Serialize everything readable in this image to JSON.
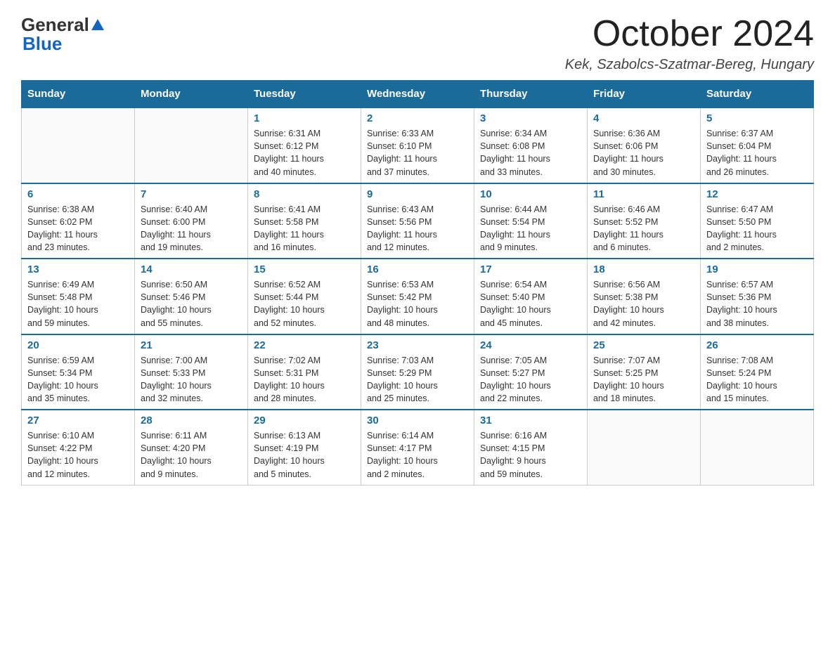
{
  "header": {
    "logo_general": "General",
    "logo_blue": "Blue",
    "month_title": "October 2024",
    "location": "Kek, Szabolcs-Szatmar-Bereg, Hungary"
  },
  "days_of_week": [
    "Sunday",
    "Monday",
    "Tuesday",
    "Wednesday",
    "Thursday",
    "Friday",
    "Saturday"
  ],
  "weeks": [
    [
      {
        "day": "",
        "info": ""
      },
      {
        "day": "",
        "info": ""
      },
      {
        "day": "1",
        "info": "Sunrise: 6:31 AM\nSunset: 6:12 PM\nDaylight: 11 hours\nand 40 minutes."
      },
      {
        "day": "2",
        "info": "Sunrise: 6:33 AM\nSunset: 6:10 PM\nDaylight: 11 hours\nand 37 minutes."
      },
      {
        "day": "3",
        "info": "Sunrise: 6:34 AM\nSunset: 6:08 PM\nDaylight: 11 hours\nand 33 minutes."
      },
      {
        "day": "4",
        "info": "Sunrise: 6:36 AM\nSunset: 6:06 PM\nDaylight: 11 hours\nand 30 minutes."
      },
      {
        "day": "5",
        "info": "Sunrise: 6:37 AM\nSunset: 6:04 PM\nDaylight: 11 hours\nand 26 minutes."
      }
    ],
    [
      {
        "day": "6",
        "info": "Sunrise: 6:38 AM\nSunset: 6:02 PM\nDaylight: 11 hours\nand 23 minutes."
      },
      {
        "day": "7",
        "info": "Sunrise: 6:40 AM\nSunset: 6:00 PM\nDaylight: 11 hours\nand 19 minutes."
      },
      {
        "day": "8",
        "info": "Sunrise: 6:41 AM\nSunset: 5:58 PM\nDaylight: 11 hours\nand 16 minutes."
      },
      {
        "day": "9",
        "info": "Sunrise: 6:43 AM\nSunset: 5:56 PM\nDaylight: 11 hours\nand 12 minutes."
      },
      {
        "day": "10",
        "info": "Sunrise: 6:44 AM\nSunset: 5:54 PM\nDaylight: 11 hours\nand 9 minutes."
      },
      {
        "day": "11",
        "info": "Sunrise: 6:46 AM\nSunset: 5:52 PM\nDaylight: 11 hours\nand 6 minutes."
      },
      {
        "day": "12",
        "info": "Sunrise: 6:47 AM\nSunset: 5:50 PM\nDaylight: 11 hours\nand 2 minutes."
      }
    ],
    [
      {
        "day": "13",
        "info": "Sunrise: 6:49 AM\nSunset: 5:48 PM\nDaylight: 10 hours\nand 59 minutes."
      },
      {
        "day": "14",
        "info": "Sunrise: 6:50 AM\nSunset: 5:46 PM\nDaylight: 10 hours\nand 55 minutes."
      },
      {
        "day": "15",
        "info": "Sunrise: 6:52 AM\nSunset: 5:44 PM\nDaylight: 10 hours\nand 52 minutes."
      },
      {
        "day": "16",
        "info": "Sunrise: 6:53 AM\nSunset: 5:42 PM\nDaylight: 10 hours\nand 48 minutes."
      },
      {
        "day": "17",
        "info": "Sunrise: 6:54 AM\nSunset: 5:40 PM\nDaylight: 10 hours\nand 45 minutes."
      },
      {
        "day": "18",
        "info": "Sunrise: 6:56 AM\nSunset: 5:38 PM\nDaylight: 10 hours\nand 42 minutes."
      },
      {
        "day": "19",
        "info": "Sunrise: 6:57 AM\nSunset: 5:36 PM\nDaylight: 10 hours\nand 38 minutes."
      }
    ],
    [
      {
        "day": "20",
        "info": "Sunrise: 6:59 AM\nSunset: 5:34 PM\nDaylight: 10 hours\nand 35 minutes."
      },
      {
        "day": "21",
        "info": "Sunrise: 7:00 AM\nSunset: 5:33 PM\nDaylight: 10 hours\nand 32 minutes."
      },
      {
        "day": "22",
        "info": "Sunrise: 7:02 AM\nSunset: 5:31 PM\nDaylight: 10 hours\nand 28 minutes."
      },
      {
        "day": "23",
        "info": "Sunrise: 7:03 AM\nSunset: 5:29 PM\nDaylight: 10 hours\nand 25 minutes."
      },
      {
        "day": "24",
        "info": "Sunrise: 7:05 AM\nSunset: 5:27 PM\nDaylight: 10 hours\nand 22 minutes."
      },
      {
        "day": "25",
        "info": "Sunrise: 7:07 AM\nSunset: 5:25 PM\nDaylight: 10 hours\nand 18 minutes."
      },
      {
        "day": "26",
        "info": "Sunrise: 7:08 AM\nSunset: 5:24 PM\nDaylight: 10 hours\nand 15 minutes."
      }
    ],
    [
      {
        "day": "27",
        "info": "Sunrise: 6:10 AM\nSunset: 4:22 PM\nDaylight: 10 hours\nand 12 minutes."
      },
      {
        "day": "28",
        "info": "Sunrise: 6:11 AM\nSunset: 4:20 PM\nDaylight: 10 hours\nand 9 minutes."
      },
      {
        "day": "29",
        "info": "Sunrise: 6:13 AM\nSunset: 4:19 PM\nDaylight: 10 hours\nand 5 minutes."
      },
      {
        "day": "30",
        "info": "Sunrise: 6:14 AM\nSunset: 4:17 PM\nDaylight: 10 hours\nand 2 minutes."
      },
      {
        "day": "31",
        "info": "Sunrise: 6:16 AM\nSunset: 4:15 PM\nDaylight: 9 hours\nand 59 minutes."
      },
      {
        "day": "",
        "info": ""
      },
      {
        "day": "",
        "info": ""
      }
    ]
  ]
}
